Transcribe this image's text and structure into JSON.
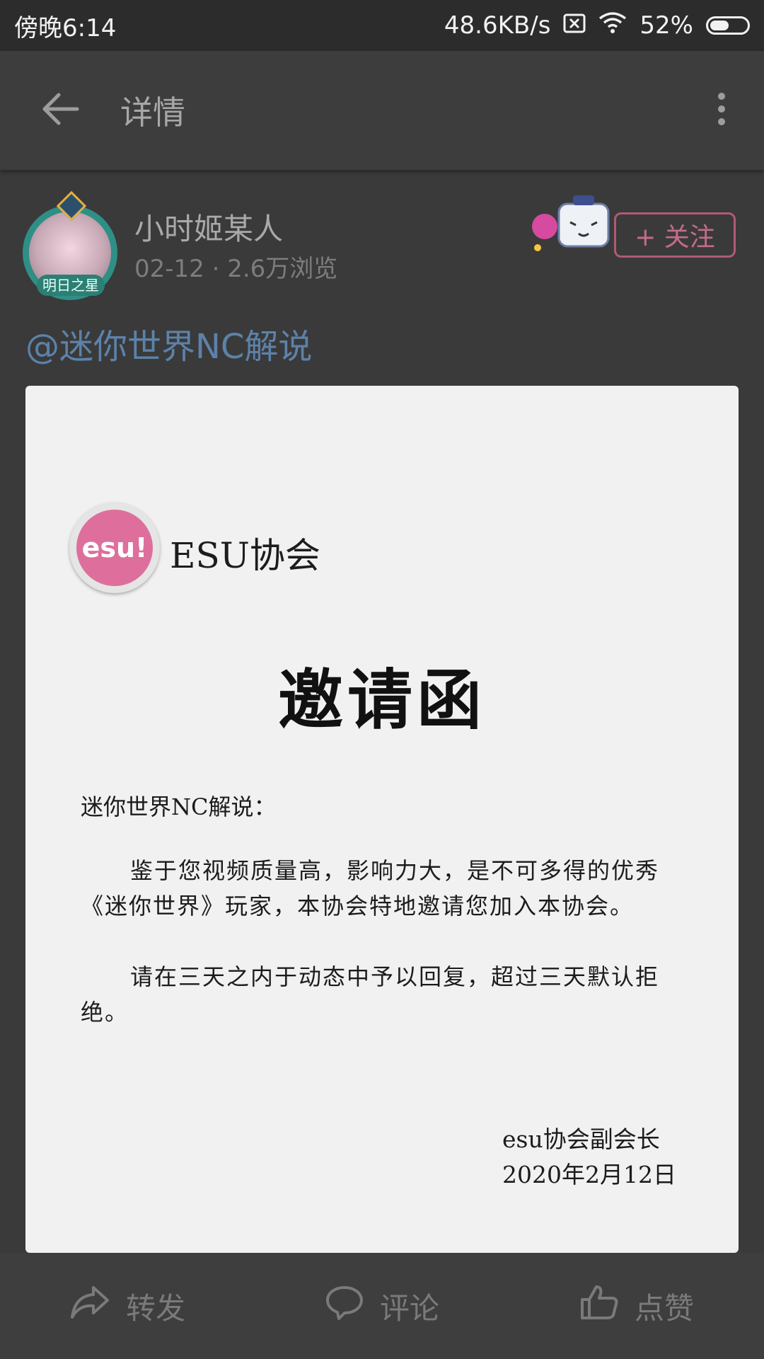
{
  "status_bar": {
    "time": "傍晚6:14",
    "network_speed": "48.6KB/s",
    "battery": "52%",
    "battery_level": 0.52
  },
  "app_bar": {
    "title": "详情"
  },
  "post": {
    "username": "小时姬某人",
    "meta": "02-12 · 2.6万浏览",
    "avatar_badge": "明日之星",
    "follow_label": "+ 关注",
    "mention": "@迷你世界NC解说"
  },
  "invitation": {
    "logo_text": "esu!",
    "org_name": "ESU协会",
    "title": "邀请函",
    "salutation": "迷你世界NC解说：",
    "paragraph1": "鉴于您视频质量高，影响力大，是不可多得的优秀《迷你世界》玩家，本协会特地邀请您加入本协会。",
    "paragraph2": "请在三天之内于动态中予以回复，超过三天默认拒绝。",
    "signer": "esu协会副会长",
    "date": "2020年2月12日"
  },
  "bottom_bar": {
    "share_label": "转发",
    "comment_label": "评论",
    "like_label": "点赞"
  }
}
